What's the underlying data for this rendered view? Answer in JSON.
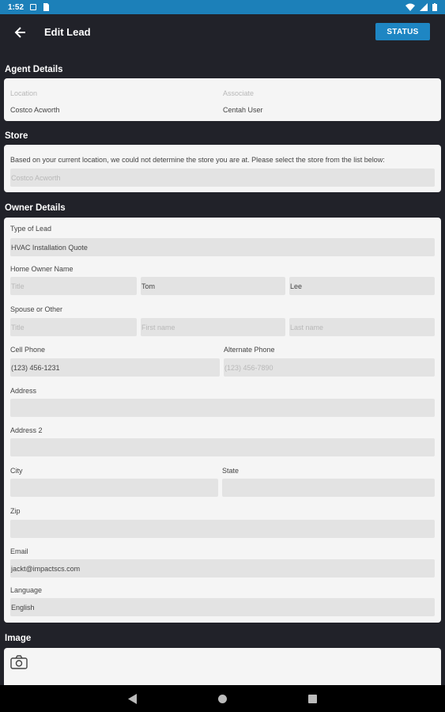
{
  "statusbar": {
    "time": "1:52"
  },
  "appbar": {
    "title": "Edit Lead",
    "status_button": "STATUS"
  },
  "agent": {
    "title": "Agent Details",
    "location_label": "Location",
    "location_value": "Costco Acworth",
    "associate_label": "Associate",
    "associate_value": "Centah User"
  },
  "store": {
    "title": "Store",
    "message": "Based on your current location, we could not determine the store you are at. Please select the store from the list below:",
    "select_value": "Costco Acworth"
  },
  "owner": {
    "title": "Owner Details",
    "type_label": "Type of Lead",
    "type_value": "HVAC Installation Quote",
    "home_owner_label": "Home Owner Name",
    "title_placeholder": "Title",
    "first_name_value": "Tom",
    "last_name_value": "Lee",
    "spouse_label": "Spouse or Other",
    "spouse_title_placeholder": "Title",
    "spouse_first_placeholder": "First name",
    "spouse_last_placeholder": "Last name",
    "cell_label": "Cell Phone",
    "cell_value": "(123) 456-1231",
    "alt_label": "Alternate Phone",
    "alt_placeholder": "(123) 456-7890",
    "address_label": "Address",
    "address2_label": "Address 2",
    "city_label": "City",
    "state_label": "State",
    "zip_label": "Zip",
    "email_label": "Email",
    "email_value": "jackt@impactscs.com",
    "language_label": "Language",
    "language_value": "English"
  },
  "image": {
    "title": "Image",
    "icon": "camera-icon"
  },
  "colors": {
    "accent": "#1e86c3",
    "background": "#212229",
    "card": "#f5f5f5",
    "field": "#e3e3e3"
  }
}
